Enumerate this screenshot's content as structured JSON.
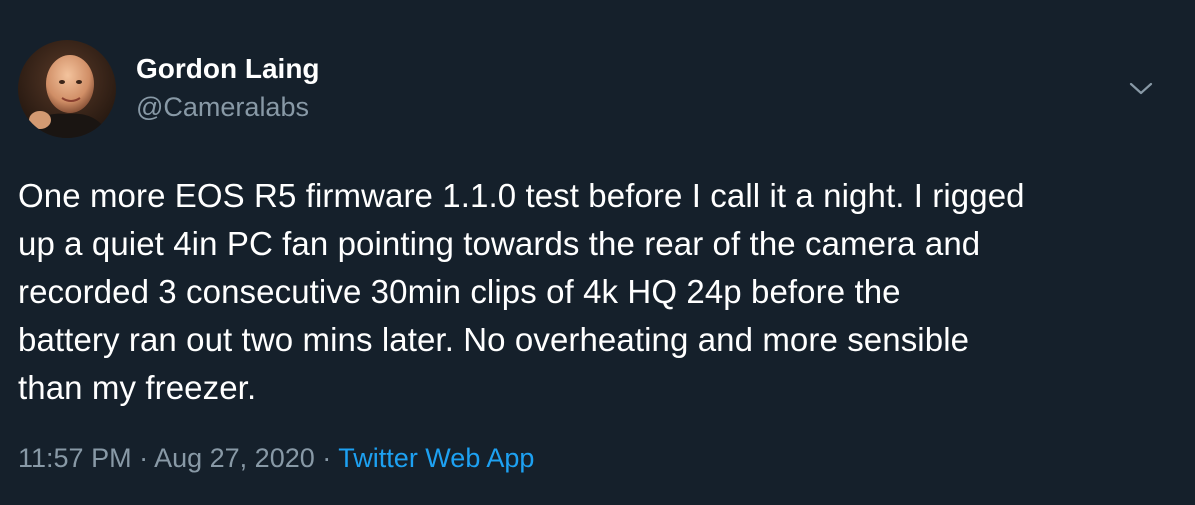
{
  "tweet": {
    "author": {
      "name": "Gordon Laing",
      "handle": "@Cameralabs"
    },
    "text": "One more EOS R5 firmware 1.1.0 test before I call it a night. I rigged\nup a quiet 4in PC fan pointing towards the rear of the camera and\nrecorded 3 consecutive 30min clips of 4k HQ 24p before the\nbattery ran out two mins later. No overheating and more sensible\nthan my freezer.",
    "time": "11:57 PM",
    "separator": "·",
    "date": "Aug 27, 2020",
    "source": "Twitter Web App"
  },
  "icons": {
    "more": "chevron-down-icon"
  },
  "colors": {
    "background": "#15202b",
    "text_primary": "#ffffff",
    "text_secondary": "#8899a6",
    "link": "#1da1f2"
  }
}
